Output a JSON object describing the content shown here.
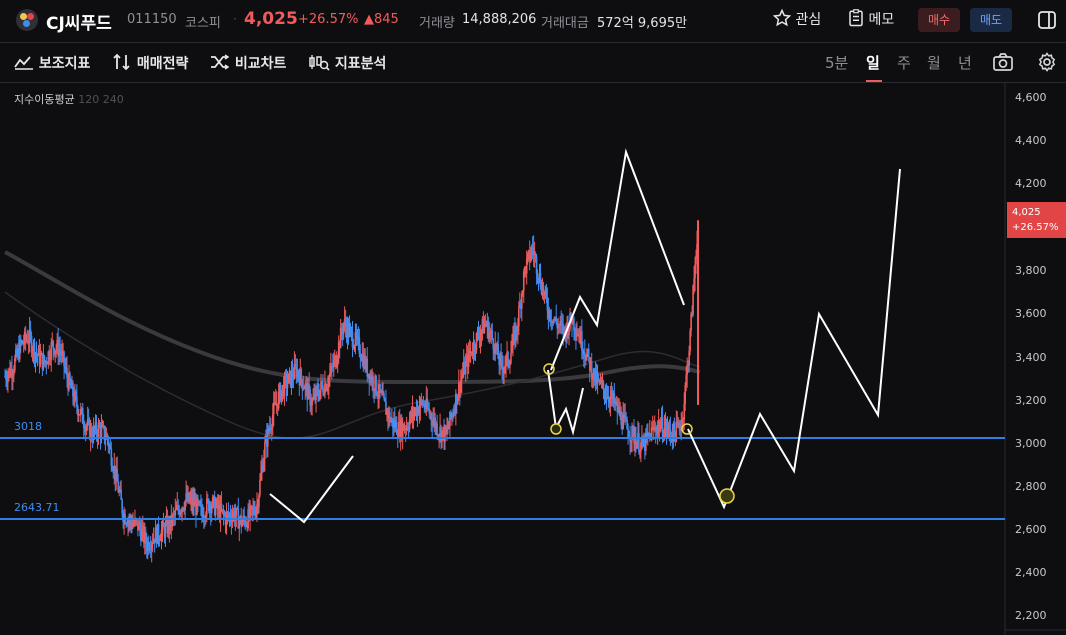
{
  "header": {
    "name": "CJ씨푸드",
    "code": "011150",
    "market": "코스피",
    "price": "4,025",
    "change_pct": "+26.57%",
    "change": "▲845",
    "volume_label": "거래량",
    "volume": "14,888,206",
    "amount_label": "거래대금",
    "amount": "572억 9,695만",
    "watch_label": "관심",
    "memo_label": "메모",
    "buy_label": "매수",
    "sell_label": "매도"
  },
  "toolbar": {
    "indicators": "보조지표",
    "strategy": "매매전략",
    "compare": "비교차트",
    "analysis": "지표분석",
    "timeframes": [
      "5분",
      "일",
      "주",
      "월",
      "년"
    ],
    "active_timeframe": "일"
  },
  "indicator": {
    "name": "지수이동평균",
    "params": "120 240"
  },
  "levels": [
    {
      "value": 3018,
      "label": "3018"
    },
    {
      "value": 2643.71,
      "label": "2643.71"
    }
  ],
  "current": {
    "price": "4,025",
    "pct": "+26.57%"
  },
  "colors": {
    "up": "#f15b5b",
    "down": "#3f8cf3",
    "level_line": "#2f7ee6"
  },
  "chart_data": {
    "type": "candlestick",
    "y_ticks": [
      "4,600",
      "4,400",
      "4,200",
      "4,000",
      "3,800",
      "3,600",
      "3,400",
      "3,200",
      "3,000",
      "2,800",
      "2,600",
      "2,400",
      "2,200"
    ],
    "ylim": [
      2150,
      4650
    ],
    "close_path": [
      3320,
      3360,
      3460,
      3500,
      3420,
      3380,
      3460,
      3440,
      3300,
      3200,
      3120,
      3060,
      3080,
      3040,
      2880,
      2700,
      2660,
      2640,
      2560,
      2600,
      2620,
      2650,
      2720,
      2760,
      2740,
      2700,
      2750,
      2720,
      2680,
      2700,
      2660,
      2680,
      2740,
      3000,
      3150,
      3250,
      3300,
      3350,
      3280,
      3200,
      3260,
      3300,
      3400,
      3560,
      3500,
      3450,
      3350,
      3280,
      3200,
      3120,
      3080,
      3100,
      3160,
      3200,
      3150,
      3080,
      3050,
      3180,
      3320,
      3420,
      3500,
      3560,
      3480,
      3360,
      3400,
      3540,
      3800,
      3900,
      3750,
      3620,
      3560,
      3520,
      3580,
      3500,
      3400,
      3300,
      3260,
      3220,
      3150,
      3080,
      3040,
      3000,
      3060,
      3100,
      3080,
      3060,
      3120,
      3500,
      4025
    ],
    "overlay_points": [
      [
        4,
        2770
      ],
      [
        11,
        2640
      ],
      [
        18,
        2940
      ]
    ]
  }
}
